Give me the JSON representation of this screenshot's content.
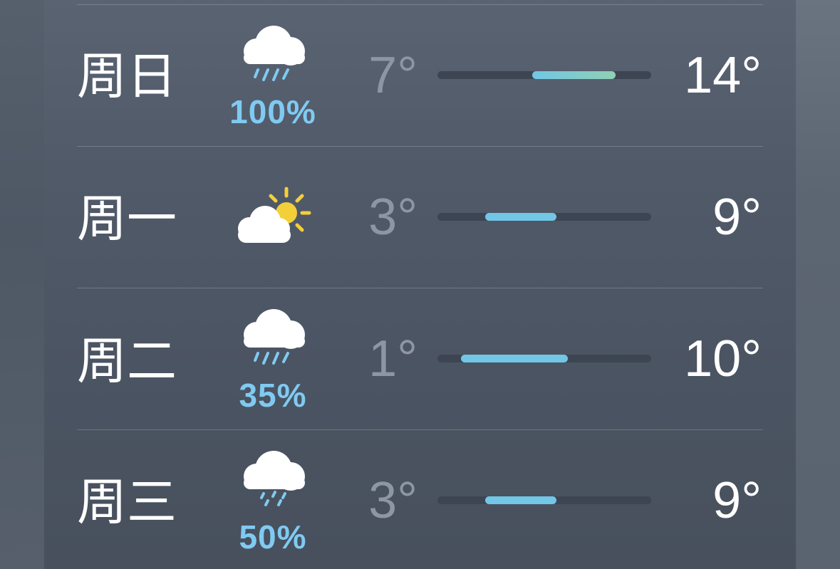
{
  "forecast": {
    "range": {
      "min": -1,
      "max": 17
    },
    "days": [
      {
        "day": "周日",
        "condition": "rain",
        "icon": "cloud-rain-icon",
        "precip": "100%",
        "low": "7°",
        "high": "14°",
        "low_value": 7,
        "high_value": 14
      },
      {
        "day": "周一",
        "condition": "partly-cloudy",
        "icon": "partly-cloudy-icon",
        "precip": "",
        "low": "3°",
        "high": "9°",
        "low_value": 3,
        "high_value": 9
      },
      {
        "day": "周二",
        "condition": "rain",
        "icon": "cloud-rain-icon",
        "precip": "35%",
        "low": "1°",
        "high": "10°",
        "low_value": 1,
        "high_value": 10
      },
      {
        "day": "周三",
        "condition": "drizzle",
        "icon": "cloud-drizzle-icon",
        "precip": "50%",
        "low": "3°",
        "high": "9°",
        "low_value": 3,
        "high_value": 9
      }
    ]
  },
  "colors": {
    "precip": "#7fcaf2",
    "bar_cool": "#72c6e6",
    "bar_warm": "#8fd0b4",
    "sun": "#f3cf3a"
  }
}
